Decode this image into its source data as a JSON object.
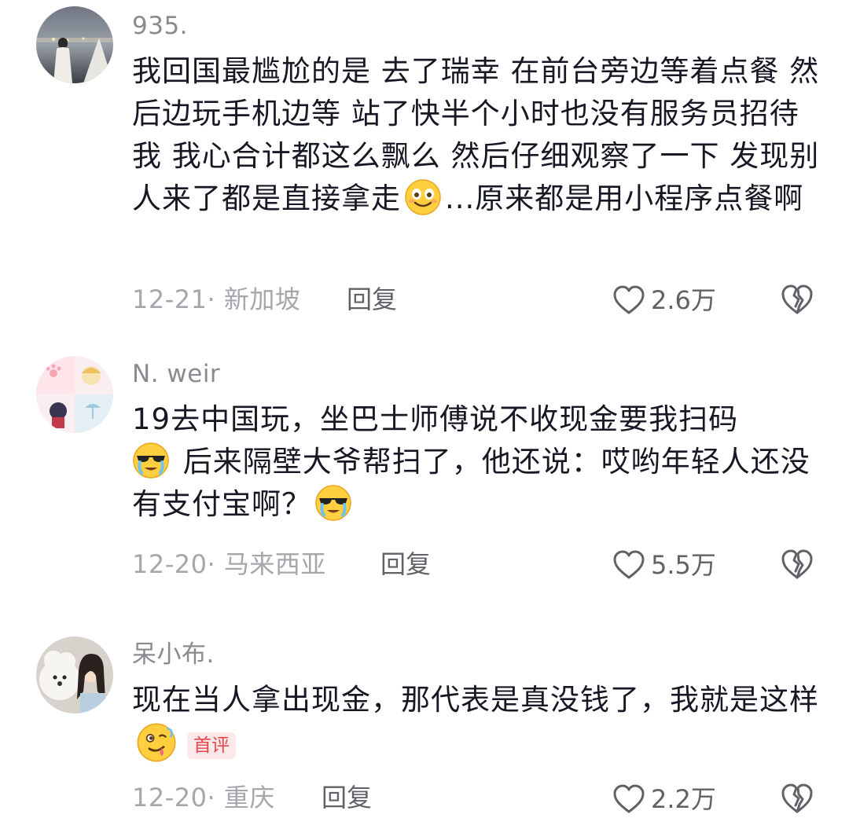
{
  "comments": [
    {
      "username": "935.",
      "text_parts": [
        "我回国最尴尬的是 去了瑞幸 在前台旁边等着点餐 然后边玩手机边等 站了快半个小时也没有服务员招待我 我心合计都这么飘么 然后仔细观察了一下 发现别人来了都是直接拿走",
        "...原来都是用小程序点餐啊"
      ],
      "emojis": [
        "grinning-emoji"
      ],
      "date": "12-21",
      "location": "· 新加坡",
      "reply_label": "回复",
      "likes": "2.6万"
    },
    {
      "username": "N. weir",
      "text_parts": [
        "19去中国玩，坐巴士师傅说不收现金要我扫码",
        " 后来隔壁大爷帮扫了，他还说：哎哟年轻人还没有支付宝啊？"
      ],
      "emojis": [
        "cool-crying-emoji",
        "cool-crying-emoji"
      ],
      "date": "12-20",
      "location": "· 马来西亚",
      "reply_label": "回复",
      "likes": "5.5万"
    },
    {
      "username": "呆小布.",
      "text_parts": [
        "现在当人拿出现金，那代表是真没钱了，我就是这样"
      ],
      "emojis": [
        "silly-emoji"
      ],
      "badge": "首评",
      "date": "12-20",
      "location": "· 重庆",
      "reply_label": "回复",
      "likes": "2.2万"
    }
  ],
  "colors": {
    "text": "#161823",
    "meta": "#a6a7ac",
    "username": "#8a8b91",
    "badge_text": "#e6464d",
    "badge_bg": "#fde9ea"
  }
}
